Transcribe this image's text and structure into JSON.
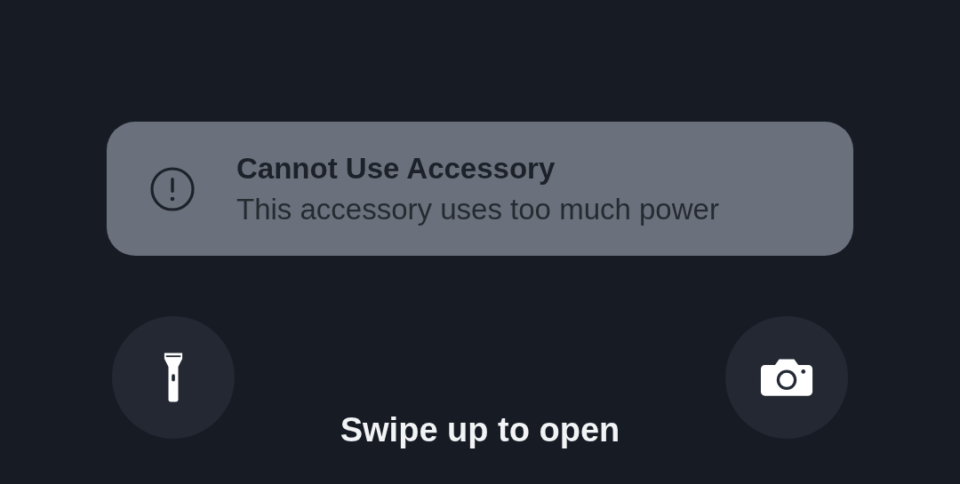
{
  "notification": {
    "title": "Cannot Use Accessory",
    "message": "This accessory uses too much power"
  },
  "quick_actions": [
    {
      "kind": "flashlight"
    },
    {
      "kind": "camera"
    }
  ],
  "hint": "Swipe up to open"
}
